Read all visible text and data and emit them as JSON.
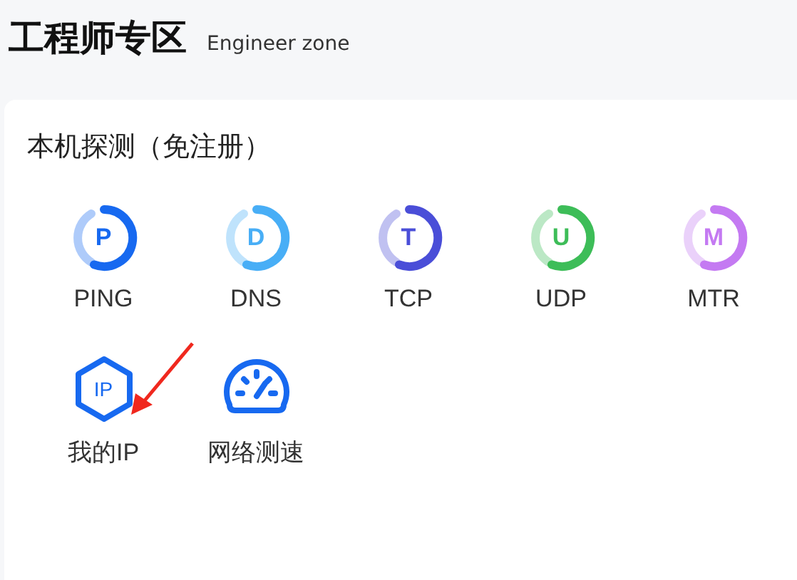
{
  "header": {
    "title": "工程师专区",
    "subtitle": "Engineer zone"
  },
  "card": {
    "title": "本机探测（免注册）",
    "tools": [
      {
        "kind": "ring",
        "glyph": "P",
        "label": "PING",
        "color": "#1769f0"
      },
      {
        "kind": "ring",
        "glyph": "D",
        "label": "DNS",
        "color": "#48aef6"
      },
      {
        "kind": "ring",
        "glyph": "T",
        "label": "TCP",
        "color": "#4a4ed8"
      },
      {
        "kind": "ring",
        "glyph": "U",
        "label": "UDP",
        "color": "#3dbd58"
      },
      {
        "kind": "ring",
        "glyph": "M",
        "label": "MTR",
        "color": "#c47af2"
      },
      {
        "kind": "hex",
        "glyph": "IP",
        "label": "我的IP",
        "color": "#1769f0"
      },
      {
        "kind": "gauge",
        "label": "网络测速",
        "color": "#1769f0"
      }
    ]
  }
}
